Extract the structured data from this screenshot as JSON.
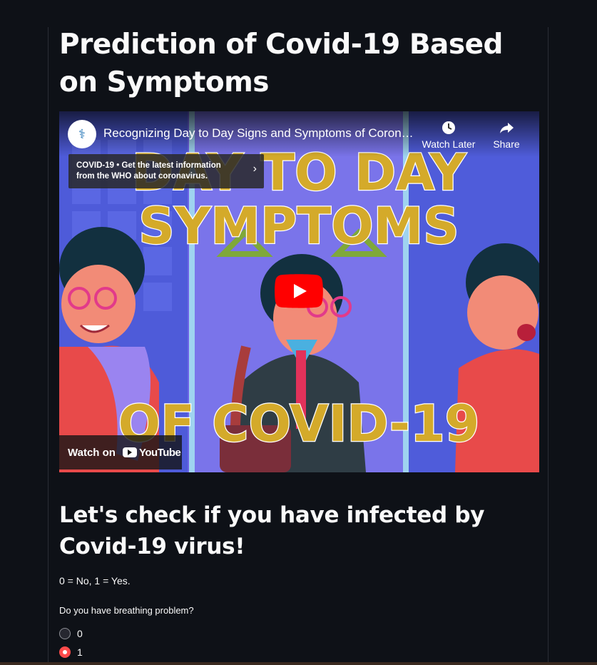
{
  "page": {
    "title": "Prediction of Covid-19 Based on Symptoms",
    "subtitle": "Let's check if you have infected by Covid-19 virus!",
    "legend": "0 = No, 1 = Yes."
  },
  "video": {
    "title": "Recognizing Day to Day Signs and Symptoms of Coronavirus",
    "watch_later_label": "Watch Later",
    "share_label": "Share",
    "info_card_text": "COVID-19 • Get the latest information from the WHO about coronavirus.",
    "thumbnail_line1": "DAY TO DAY",
    "thumbnail_line2": "SYMPTOMS",
    "thumbnail_line3": "OF COVID-19",
    "watch_on_label": "Watch on",
    "youtube_word": "YouTube"
  },
  "question": {
    "label": "Do you have breathing problem?",
    "options": [
      {
        "label": "0",
        "selected": false
      },
      {
        "label": "1",
        "selected": true
      }
    ]
  },
  "colors": {
    "background": "#0e1117",
    "accent": "#ff4b4b",
    "text": "#fafafa",
    "thumbnail_text": "#d4aa2a",
    "youtube_red": "#ff0000"
  },
  "icons": [
    "clock-icon",
    "share-arrow-icon",
    "chevron-right-icon",
    "play-icon",
    "channel-logo-icon"
  ]
}
